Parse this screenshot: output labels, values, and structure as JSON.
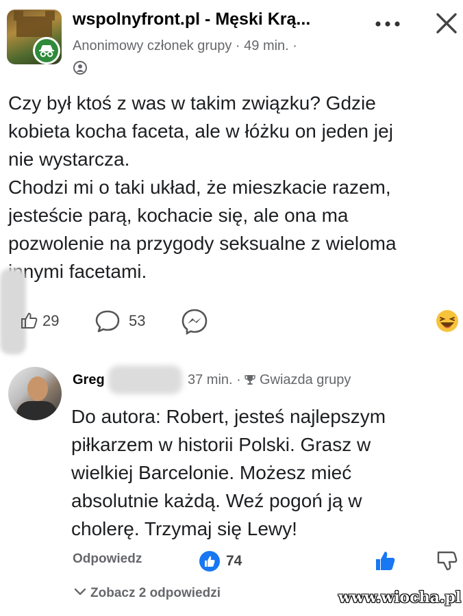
{
  "post": {
    "group_name": "wspolnyfront.pl - Męski Krą...",
    "author": "Anonimowy członek grupy",
    "separator": "·",
    "time": "49 min.",
    "dot": "·",
    "text": "Czy był ktoś z was w takim związku? Gdzie\nkobieta kocha faceta, ale w łóżku on jeden jej\nnie wystarcza.\nChodzi mi o taki układ, że mieszkacie razem,\njesteście parą, kochacie się, ale ona ma\npozwolenie na przygody seksualne z wieloma\ninnymi facetami.",
    "likes": "29",
    "comments": "53"
  },
  "comment": {
    "author": "Greg",
    "time": "37 min. ·",
    "badge": "Gwiazda grupy",
    "text": "Do autora: Robert, jesteś najlepszym\npiłkarzem w historii Polski. Grasz w\nwielkiej Barcelonie. Możesz mieć\nabsolutnie każdą. Weź pogoń ją w\ncholerę. Trzymaj się Lewy!",
    "reply_label": "Odpowiedz",
    "reaction_count": "74",
    "see_replies": "Zobacz 2 odpowiedzi"
  },
  "watermark": "www.wiocha.pl",
  "icons": {
    "more": "more-icon",
    "close": "close-icon",
    "privacy": "privacy-icon",
    "like": "like-icon",
    "comment": "comment-icon",
    "messenger": "messenger-icon",
    "haha": "haha-reaction-icon",
    "trophy": "trophy-icon",
    "thumb_up": "thumb-up-icon",
    "thumb_down": "thumb-down-icon",
    "chevron": "chevron-down-icon"
  },
  "colors": {
    "brand_blue": "#1877f2",
    "meta_gray": "#65676b",
    "anon_green": "#2f8a3a"
  }
}
